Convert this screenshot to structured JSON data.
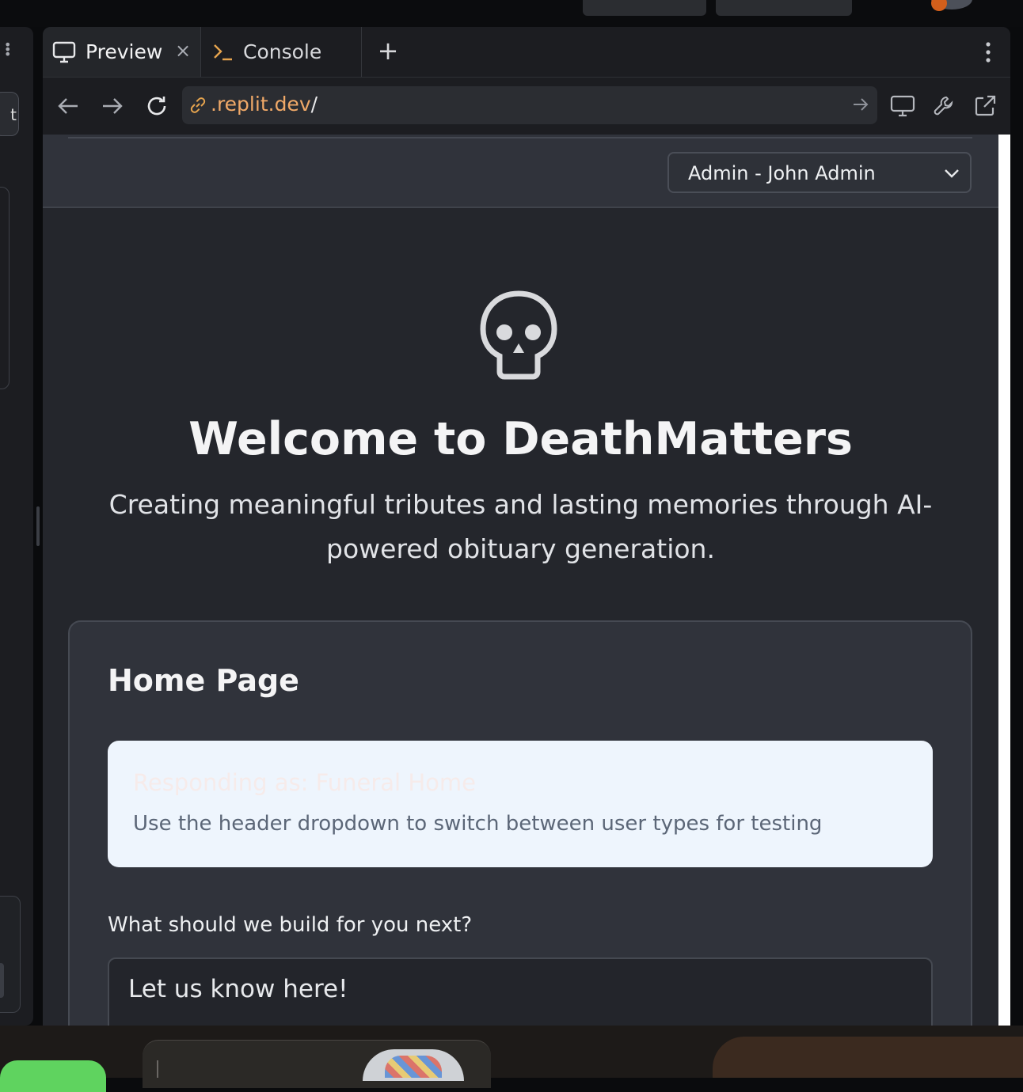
{
  "tabs": {
    "preview_label": "Preview",
    "console_label": "Console"
  },
  "address_bar": {
    "url_domain": ".replit.dev",
    "url_path": "/"
  },
  "header": {
    "user_select_value": "Admin - John Admin"
  },
  "hero": {
    "title": "Welcome to DeathMatters",
    "tagline": "Creating meaningful tributes and lasting memories through AI-powered obituary generation."
  },
  "home_card": {
    "title": "Home Page",
    "notice_title": "Responding as: Funeral Home",
    "notice_body": "Use the header dropdown to switch between user types for testing",
    "build_label": "What should we build for you next?",
    "build_input_text": "Let us know here!"
  },
  "left_panel": {
    "button_partial": "t"
  },
  "icons": {
    "preview_tab": "monitor-icon",
    "console_tab": "terminal-icon",
    "close_tab": "close-icon",
    "new_tab": "plus-icon",
    "tab_menu": "kebab-menu-icon",
    "back": "arrow-left-icon",
    "forward": "arrow-right-icon",
    "reload": "reload-icon",
    "link": "link-icon",
    "go": "arrow-right-icon",
    "device": "monitor-icon",
    "devtools": "wrench-icon",
    "open_external": "external-link-icon",
    "hero": "skull-icon",
    "select_chevron": "chevron-down-icon"
  },
  "colors": {
    "url_domain": "#f0a968",
    "page_background": "#24262c",
    "card_background": "#30333b",
    "notice_background": "#eef5fd"
  }
}
